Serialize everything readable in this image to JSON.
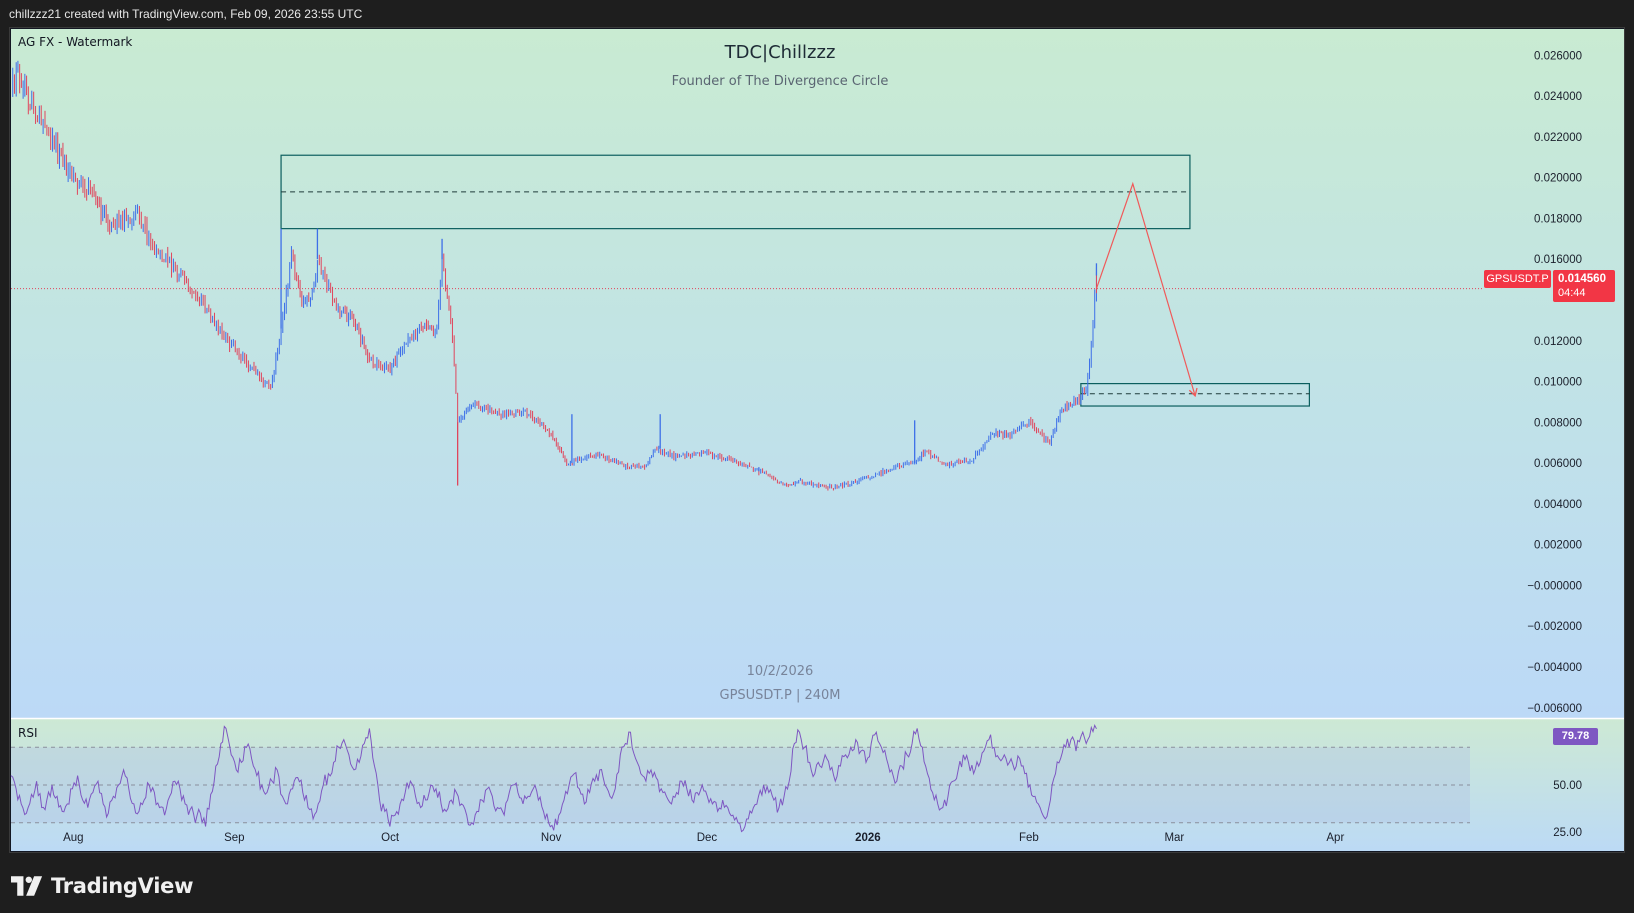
{
  "header": {
    "attribution": "chillzzz21 created with TradingView.com, Feb 09, 2026 23:55 UTC"
  },
  "watermark": {
    "corner": "AG FX - Watermark",
    "title": "TDC|Chillzzz",
    "subtitle": "Founder of The Divergence Circle",
    "date": "10/2/2026",
    "symbol_interval": "GPSUSDT.P | 240M"
  },
  "price_tag": {
    "symbol": "GPSUSDT.P",
    "price": "0.014560",
    "countdown": "04:44"
  },
  "rsi_panel": {
    "label": "RSI",
    "value_tag": "79.78"
  },
  "footer": {
    "brand": "TradingView"
  },
  "colors": {
    "up": "#3d6fe8",
    "down": "#e0455c",
    "rsi": "#7e57c2",
    "arrow": "#f05a5a",
    "zone": "#0b5e5e",
    "price_line": "#e0455c",
    "tag_bg": "#f23645",
    "rsi_tag_bg": "#7e57c2"
  },
  "chart_data": {
    "type": "candlestick",
    "symbol": "GPSUSDT.P",
    "interval": "240M",
    "price_axis": {
      "ticks": [
        "0.026000",
        "0.024000",
        "0.022000",
        "0.020000",
        "0.018000",
        "0.016000",
        "0.012000",
        "0.010000",
        "0.008000",
        "0.006000",
        "0.004000",
        "0.002000",
        "−0.000000",
        "−0.002000",
        "−0.004000",
        "−0.006000"
      ],
      "range": [
        -0.0065,
        0.0268
      ]
    },
    "time_axis": {
      "labels": [
        "Aug",
        "Sep",
        "Oct",
        "Nov",
        "Dec",
        "2026",
        "Feb",
        "Mar",
        "Apr"
      ],
      "range": [
        "2025-07-20",
        "2026-04-25"
      ]
    },
    "last_price": 0.01456,
    "price_path": [
      [
        "2025-07-20",
        0.0245
      ],
      [
        "2025-07-21",
        0.0252
      ],
      [
        "2025-07-24",
        0.0236
      ],
      [
        "2025-07-28",
        0.0218
      ],
      [
        "2025-07-31",
        0.0203
      ],
      [
        "2025-08-05",
        0.019
      ],
      [
        "2025-08-08",
        0.0176
      ],
      [
        "2025-08-13",
        0.0182
      ],
      [
        "2025-08-17",
        0.0165
      ],
      [
        "2025-08-21",
        0.0154
      ],
      [
        "2025-08-26",
        0.0137
      ],
      [
        "2025-08-30",
        0.0123
      ],
      [
        "2025-09-03",
        0.011
      ],
      [
        "2025-09-08",
        0.0097
      ],
      [
        "2025-09-10",
        0.0126
      ],
      [
        "2025-09-12",
        0.0162
      ],
      [
        "2025-09-14",
        0.0138
      ],
      [
        "2025-09-16",
        0.0143
      ],
      [
        "2025-09-17",
        0.016
      ],
      [
        "2025-09-21",
        0.0135
      ],
      [
        "2025-09-24",
        0.013
      ],
      [
        "2025-09-27",
        0.0111
      ],
      [
        "2025-10-01",
        0.0105
      ],
      [
        "2025-10-03",
        0.0116
      ],
      [
        "2025-10-07",
        0.0128
      ],
      [
        "2025-10-10",
        0.0125
      ],
      [
        "2025-10-11",
        0.016
      ],
      [
        "2025-10-13",
        0.0122
      ],
      [
        "2025-10-14",
        0.008
      ],
      [
        "2025-10-17",
        0.009
      ],
      [
        "2025-10-22",
        0.0084
      ],
      [
        "2025-10-27",
        0.0085
      ],
      [
        "2025-11-01",
        0.0075
      ],
      [
        "2025-11-04",
        0.006
      ],
      [
        "2025-11-10",
        0.0064
      ],
      [
        "2025-11-15",
        0.0059
      ],
      [
        "2025-11-19",
        0.0058
      ],
      [
        "2025-11-21",
        0.0067
      ],
      [
        "2025-11-25",
        0.0063
      ],
      [
        "2025-12-01",
        0.0065
      ],
      [
        "2025-12-06",
        0.0061
      ],
      [
        "2025-12-11",
        0.0056
      ],
      [
        "2025-12-16",
        0.0049
      ],
      [
        "2025-12-19",
        0.0051
      ],
      [
        "2025-12-25",
        0.0048
      ],
      [
        "2025-12-31",
        0.0052
      ],
      [
        "2026-01-06",
        0.0058
      ],
      [
        "2026-01-10",
        0.006
      ],
      [
        "2026-01-12",
        0.0066
      ],
      [
        "2026-01-16",
        0.0059
      ],
      [
        "2026-01-21",
        0.0062
      ],
      [
        "2026-01-25",
        0.0075
      ],
      [
        "2026-01-28",
        0.0074
      ],
      [
        "2026-02-01",
        0.008
      ],
      [
        "2026-02-05",
        0.007
      ],
      [
        "2026-02-07",
        0.0086
      ],
      [
        "2026-02-10",
        0.0091
      ],
      [
        "2026-02-12",
        0.0095
      ],
      [
        "2026-02-13",
        0.0118
      ],
      [
        "2026-02-14",
        0.0152
      ],
      [
        "2026-02-14",
        0.01456
      ]
    ],
    "wick_spikes": [
      [
        "2025-09-10",
        0.0175
      ],
      [
        "2025-09-17",
        0.0175
      ],
      [
        "2025-10-11",
        0.017
      ],
      [
        "2025-10-14",
        0.0049
      ],
      [
        "2025-11-05",
        0.0084
      ],
      [
        "2025-11-22",
        0.0084
      ],
      [
        "2025-12-11",
        0.0058
      ],
      [
        "2026-01-10",
        0.0081
      ],
      [
        "2026-02-14",
        0.0158
      ]
    ],
    "zones": [
      {
        "from": "2025-09-10",
        "to": "2026-03-04",
        "top": 0.0211,
        "bottom": 0.0175,
        "mid": 0.0193
      },
      {
        "from": "2026-02-11",
        "to": "2026-03-27",
        "top": 0.0099,
        "bottom": 0.0088,
        "mid": 0.0094
      }
    ],
    "projection": [
      [
        "2026-02-14",
        0.01456
      ],
      [
        "2026-02-21",
        0.0197
      ],
      [
        "2026-03-05",
        0.0093
      ]
    ],
    "rsi": {
      "label": "RSI",
      "last": 79.78,
      "levels": [
        70,
        50,
        30
      ],
      "axis_ticks": [
        "50.00",
        "25.00"
      ],
      "range": [
        15,
        85
      ],
      "values": [
        55,
        48,
        40,
        35,
        45,
        52,
        38,
        42,
        50,
        44,
        36,
        40,
        48,
        55,
        42,
        38,
        46,
        52,
        40,
        35,
        44,
        50,
        58,
        48,
        40,
        36,
        42,
        50,
        46,
        38,
        34,
        44,
        52,
        48,
        40,
        37,
        30,
        35,
        28,
        45,
        60,
        72,
        80,
        66,
        58,
        62,
        70,
        64,
        55,
        50,
        46,
        52,
        58,
        44,
        40,
        48,
        54,
        46,
        38,
        32,
        40,
        50,
        56,
        62,
        70,
        74,
        66,
        58,
        62,
        72,
        80,
        60,
        42,
        36,
        28,
        34,
        40,
        46,
        52,
        44,
        38,
        42,
        50,
        48,
        40,
        36,
        42,
        46,
        40,
        34,
        30,
        36,
        42,
        48,
        44,
        38,
        36,
        42,
        50,
        46,
        40,
        44,
        48,
        42,
        36,
        30,
        26,
        34,
        42,
        50,
        56,
        48,
        40,
        46,
        52,
        58,
        50,
        44,
        48,
        66,
        72,
        78,
        64,
        56,
        52,
        58,
        54,
        48,
        44,
        40,
        46,
        52,
        48,
        42,
        46,
        50,
        44,
        40,
        36,
        42,
        38,
        34,
        30,
        26,
        32,
        38,
        44,
        50,
        46,
        42,
        38,
        44,
        52,
        72,
        78,
        70,
        62,
        56,
        60,
        66,
        58,
        52,
        60,
        66,
        70,
        74,
        68,
        62,
        72,
        78,
        70,
        64,
        58,
        52,
        60,
        66,
        72,
        80,
        70,
        56,
        46,
        40,
        38,
        44,
        52,
        58,
        66,
        62,
        56,
        60,
        68,
        74,
        70,
        64,
        66,
        62,
        58,
        64,
        56,
        50,
        44,
        38,
        32,
        42,
        56,
        64,
        70,
        74,
        68,
        76,
        72,
        80.5,
        79.78
      ]
    }
  }
}
